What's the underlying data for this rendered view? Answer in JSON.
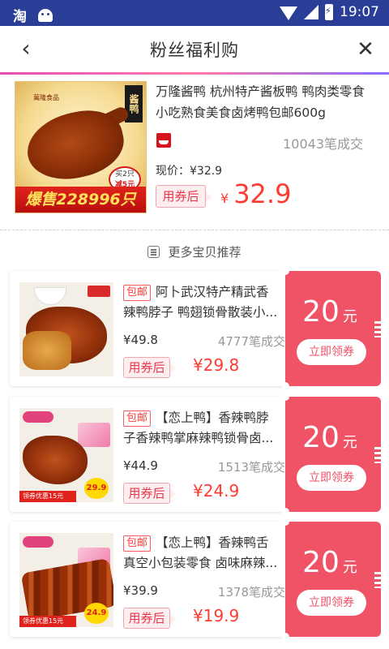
{
  "status_bar": {
    "app_glyph": "淘",
    "time": "19:07"
  },
  "header": {
    "back_glyph": "‹",
    "title": "粉丝福利购",
    "close_glyph": "✕"
  },
  "main_product": {
    "image_banner": "爆售228996只",
    "image_brand": "萬隆食品",
    "image_side_label": "酱鸭",
    "image_promo_line1": "买2只",
    "image_promo_line2": "减5元",
    "title": "万隆酱鸭 杭州特产酱板鸭 鸭肉类零食小吃熟食美食卤烤鸭包邮600g",
    "sales": "10043笔成交",
    "current_price": "现价：¥32.9",
    "coupon_tag": "用券后",
    "final_currency": "¥",
    "final_price": "32.9"
  },
  "more_section": {
    "title": "更多宝贝推荐"
  },
  "items": [
    {
      "tag": "包邮",
      "title": "阿卜武汉特产精武香辣鸭脖子 鸭翅锁骨散装小...",
      "price": "¥49.8",
      "sales": "4777笔成交",
      "coupon_tag": "用券后",
      "final_price": "¥29.8",
      "coupon_amount": "20",
      "coupon_unit": "元",
      "coupon_button": "立即领券"
    },
    {
      "tag": "包邮",
      "title": "【恋上鸭】香辣鸭脖子香辣鸭掌麻辣鸭锁骨卤...",
      "price": "¥44.9",
      "sales": "1513笔成交",
      "coupon_tag": "用券后",
      "final_price": "¥24.9",
      "coupon_amount": "20",
      "coupon_unit": "元",
      "coupon_button": "立即领券",
      "image_bar": "领券优惠15元",
      "image_price": "29.9"
    },
    {
      "tag": "包邮",
      "title": "【恋上鸭】香辣鸭舌真空小包装零食 卤味麻辣...",
      "price": "¥39.9",
      "sales": "1378笔成交",
      "coupon_tag": "用券后",
      "final_price": "¥19.9",
      "coupon_amount": "20",
      "coupon_unit": "元",
      "coupon_button": "立即领券",
      "image_bar": "领券优惠15元",
      "image_price": "24.9"
    }
  ],
  "colors": {
    "status_bar": "#2b3e97",
    "accent_red": "#ff3b30",
    "coupon_bg": "#f05266"
  }
}
